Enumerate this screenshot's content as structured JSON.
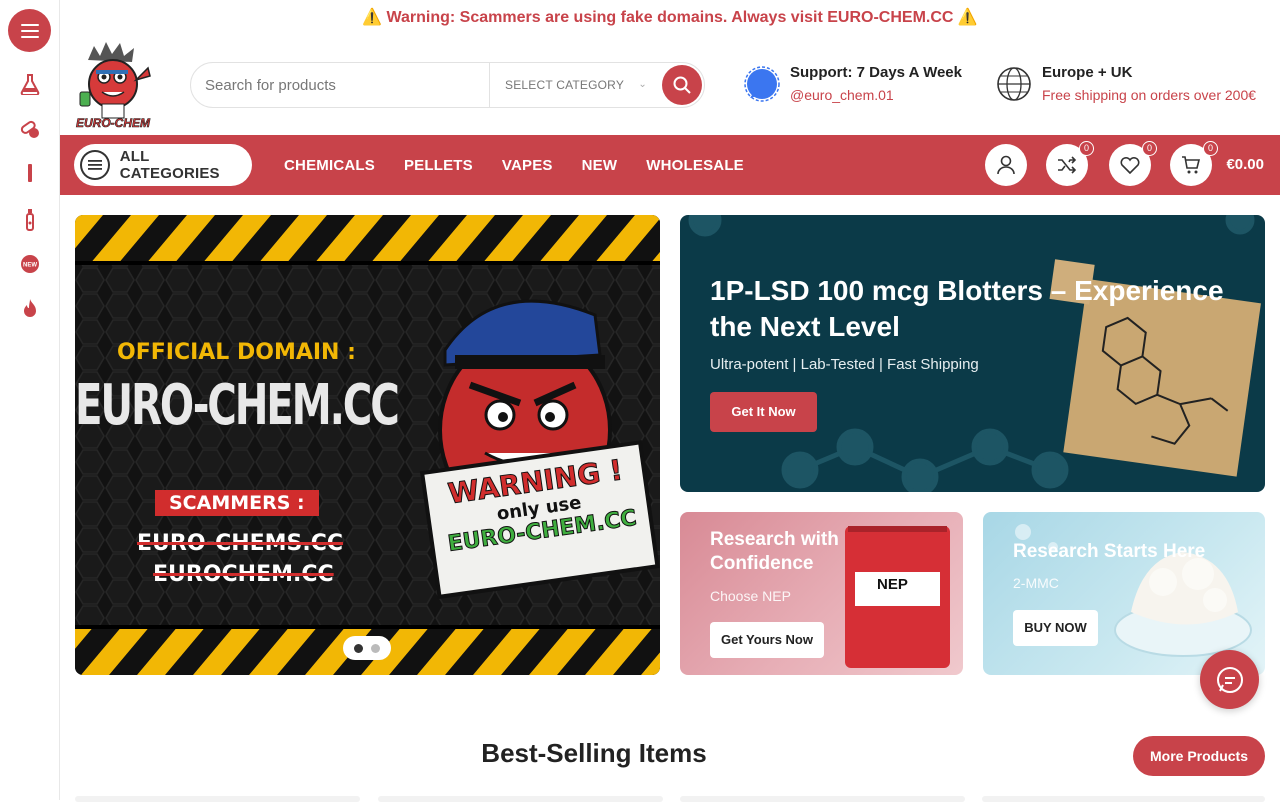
{
  "topbar": {
    "warning": "⚠️ Warning: Scammers are using fake domains. Always visit EURO-CHEM.CC ⚠️"
  },
  "logo": {
    "text": "EURO-CHEM"
  },
  "search": {
    "placeholder": "Search for products",
    "category": "SELECT CATEGORY"
  },
  "support": {
    "title": "Support: 7 Days A Week",
    "handle": "@euro_chem.01"
  },
  "shipping": {
    "title": "Europe + UK",
    "note": "Free shipping on orders over 200€"
  },
  "nav": {
    "all_categories": "ALL CATEGORIES",
    "links": [
      "CHEMICALS",
      "PELLETS",
      "VAPES",
      "NEW",
      "WHOLESALE"
    ],
    "compare_count": "0",
    "wishlist_count": "0",
    "cart_count": "0",
    "cart_total": "€0.00"
  },
  "sidebar": {
    "items": [
      "flask-icon",
      "pills-icon",
      "pellet-icon",
      "vape-icon",
      "new-badge-icon",
      "fire-icon"
    ]
  },
  "hero": {
    "official": "OFFICIAL DOMAIN :",
    "domain": "EURO-CHEM.CC",
    "scammers": "SCAMMERS :",
    "fake1": "EURO-CHEMS.CC",
    "fake2": "EUROCHEM.CC",
    "sign1": "WARNING !",
    "sign2": "only use",
    "sign3": "EURO-CHEM.CC"
  },
  "banner1": {
    "title": "1P-LSD 100 mcg Blotters – Experience the Next Level",
    "subtitle": "Ultra-potent | Lab-Tested | Fast Shipping",
    "button": "Get It Now"
  },
  "banner2": {
    "title": "Research with Confidence",
    "subtitle": "Choose NEP",
    "button": "Get Yours Now",
    "bag_label": "NEP"
  },
  "banner3": {
    "title": "Research Starts Here",
    "subtitle": "2-MMC",
    "button": "BUY NOW"
  },
  "section": {
    "title": "Best-Selling Items",
    "more": "More Products"
  },
  "colors": {
    "brand": "#c8434a",
    "dark_teal": "#0b3a48"
  }
}
